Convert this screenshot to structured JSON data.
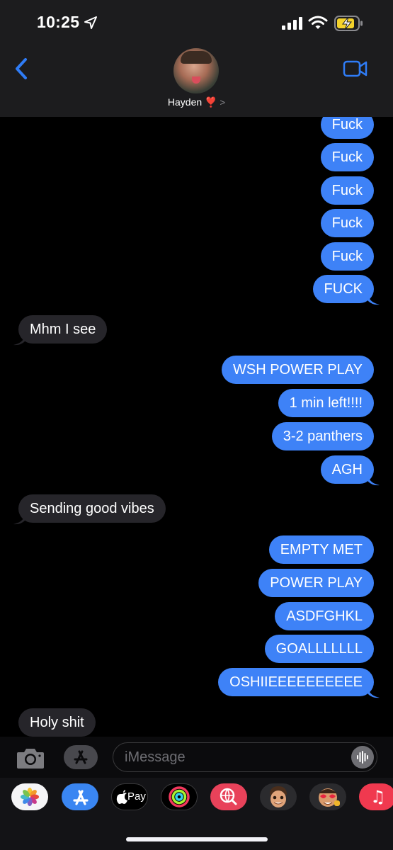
{
  "status_bar": {
    "time": "10:25",
    "icons": [
      "location-arrow-icon",
      "cellular-signal-icon",
      "wifi-icon",
      "battery-charging-icon"
    ]
  },
  "header": {
    "contact_name": "Hayden ❣️",
    "chevron": ">",
    "back_icon": "chevron-left-icon",
    "video_icon": "facetime-video-icon",
    "accent_color": "#2f7cf6"
  },
  "messages": [
    {
      "from": "me",
      "text": "Fuck"
    },
    {
      "from": "me",
      "text": "Fuck"
    },
    {
      "from": "me",
      "text": "Fuck"
    },
    {
      "from": "me",
      "text": "Fuck"
    },
    {
      "from": "me",
      "text": "Fuck"
    },
    {
      "from": "me",
      "text": "FUCK"
    },
    {
      "from": "them",
      "text": "Mhm I see"
    },
    {
      "from": "me",
      "text": "WSH POWER PLAY"
    },
    {
      "from": "me",
      "text": "1 min left!!!!"
    },
    {
      "from": "me",
      "text": "3-2 panthers"
    },
    {
      "from": "me",
      "text": "AGH"
    },
    {
      "from": "them",
      "text": "Sending good vibes"
    },
    {
      "from": "me",
      "text": "EMPTY MET"
    },
    {
      "from": "me",
      "text": "POWER PLAY"
    },
    {
      "from": "me",
      "text": "ASDFGHKL"
    },
    {
      "from": "me",
      "text": "GOALLLLLLL"
    },
    {
      "from": "me",
      "text": "OSHIIEEEEEEEEEE"
    },
    {
      "from": "them",
      "text": "Holy shit"
    }
  ],
  "colors": {
    "sent_bubble": "#3e82f7",
    "received_bubble": "#26252a"
  },
  "input": {
    "placeholder": "iMessage",
    "camera_icon": "camera-icon",
    "apps_icon": "app-store-icon",
    "audio_icon": "audio-waveform-icon"
  },
  "app_drawer": {
    "apps": [
      {
        "name": "photos-icon"
      },
      {
        "name": "app-store-icon"
      },
      {
        "name": "apple-pay-icon",
        "label": "Pay"
      },
      {
        "name": "activity-icon"
      },
      {
        "name": "web-search-icon"
      },
      {
        "name": "memoji-icon"
      },
      {
        "name": "memoji-stickers-icon"
      },
      {
        "name": "music-icon",
        "label": "♫"
      }
    ]
  }
}
